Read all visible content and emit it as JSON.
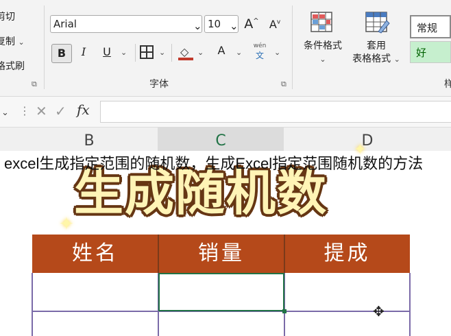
{
  "ribbon": {
    "clipboard": {
      "cut": "剪切",
      "copy": "复制",
      "format_painter": "格式刷"
    },
    "font": {
      "name": "Arial",
      "size": "10",
      "increase": "A",
      "decrease": "A",
      "bold": "B",
      "italic": "I",
      "underline": "U",
      "font_color": "A",
      "phonetic_top": "wén",
      "phonetic_bottom": "文",
      "group_label": "字体"
    },
    "styles": {
      "conditional_format": "条件格式",
      "format_as_table_line1": "套用",
      "format_as_table_line2": "表格格式",
      "normal": "常规",
      "good": "好",
      "cut_off": "样"
    }
  },
  "formula_bar": {
    "fx": "fx",
    "cancel": "✕",
    "confirm": "✓"
  },
  "columns": [
    "B",
    "C",
    "D"
  ],
  "caption": "excel生成指定范围的随机数，生成Excel指定范围随机数的方法",
  "overlay_title": "生成随机数",
  "table": {
    "headers": [
      "姓名",
      "销量",
      "提成"
    ]
  },
  "colors": {
    "header_fill": "#b5491a",
    "excel_green": "#217346",
    "good_fill": "#c6efce"
  }
}
